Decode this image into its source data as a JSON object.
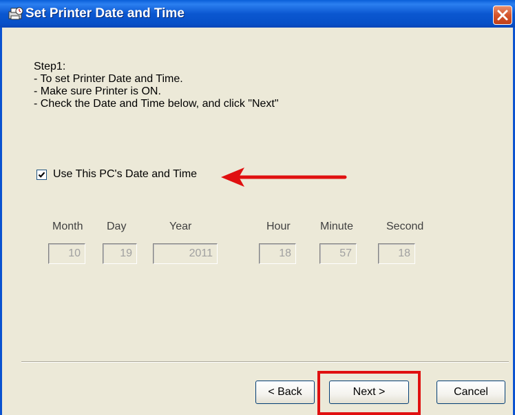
{
  "window": {
    "title": "Set Printer Date and Time"
  },
  "instructions": {
    "lines": [
      "Step1:",
      "- To set Printer Date and Time.",
      "- Make sure Printer is ON.",
      "- Check the Date and Time below, and click \"Next\""
    ]
  },
  "use_pc_time": {
    "label": "Use This PC's Date and Time",
    "checked": true
  },
  "fields": [
    {
      "label": "Month",
      "value": "10"
    },
    {
      "label": "Day",
      "value": "19"
    },
    {
      "label": "Year",
      "value": "2011"
    },
    {
      "label": "Hour",
      "value": "18"
    },
    {
      "label": "Minute",
      "value": "57"
    },
    {
      "label": "Second",
      "value": "18"
    }
  ],
  "buttons": {
    "back": "< Back",
    "next": "Next >",
    "cancel": "Cancel"
  },
  "colors": {
    "annotation": "#e01010",
    "titlebar": "#0b57d0",
    "dialog_bg": "#ece9d8"
  }
}
